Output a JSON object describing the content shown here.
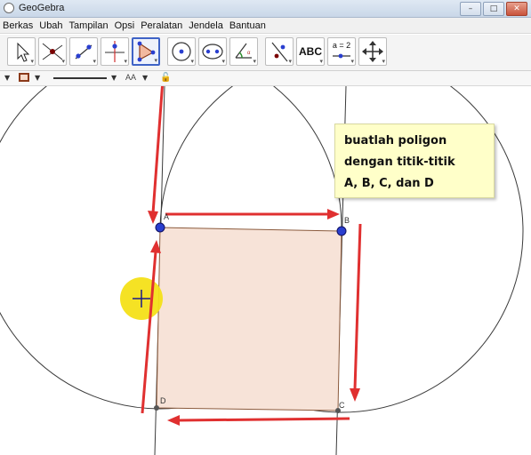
{
  "window": {
    "title": "GeoGebra"
  },
  "menu": [
    "Berkas",
    "Ubah",
    "Tampilan",
    "Opsi",
    "Peralatan",
    "Jendela",
    "Bantuan"
  ],
  "toolbar": {
    "tools": [
      {
        "name": "move-tool",
        "icon": "arrow-cursor-icon"
      },
      {
        "name": "point-tool",
        "icon": "point-on-lines-icon"
      },
      {
        "name": "line-tool",
        "icon": "line-through-points-icon"
      },
      {
        "name": "perpendicular-tool",
        "icon": "perpendicular-line-icon"
      },
      {
        "name": "polygon-tool",
        "icon": "polygon-icon",
        "active": true
      },
      {
        "name": "circle-tool",
        "icon": "circle-center-point-icon"
      },
      {
        "name": "conic-tool",
        "icon": "ellipse-icon"
      },
      {
        "name": "angle-tool",
        "icon": "angle-icon"
      },
      {
        "name": "reflect-tool",
        "icon": "reflect-about-line-icon"
      },
      {
        "name": "text-tool",
        "icon": "text-icon",
        "label": "ABC"
      },
      {
        "name": "slider-tool",
        "icon": "slider-icon",
        "label": "a = 2"
      },
      {
        "name": "move-view-tool",
        "icon": "move-graphics-view-icon"
      }
    ]
  },
  "stylebar": {
    "fill_color": "#8b3a1a",
    "aa_label": "AA"
  },
  "note": {
    "lines": [
      "buatlah poligon",
      "dengan titik-titik",
      "A, B, C, dan D"
    ]
  },
  "points": {
    "a": "A",
    "b": "B",
    "c": "C",
    "d": "D"
  },
  "colors": {
    "polygon_fill": "#f7e3d8",
    "polygon_stroke": "#8b5a3c",
    "arrow": "#e03030",
    "point_blue": "#2a3fcf",
    "highlight": "#f4e018"
  }
}
